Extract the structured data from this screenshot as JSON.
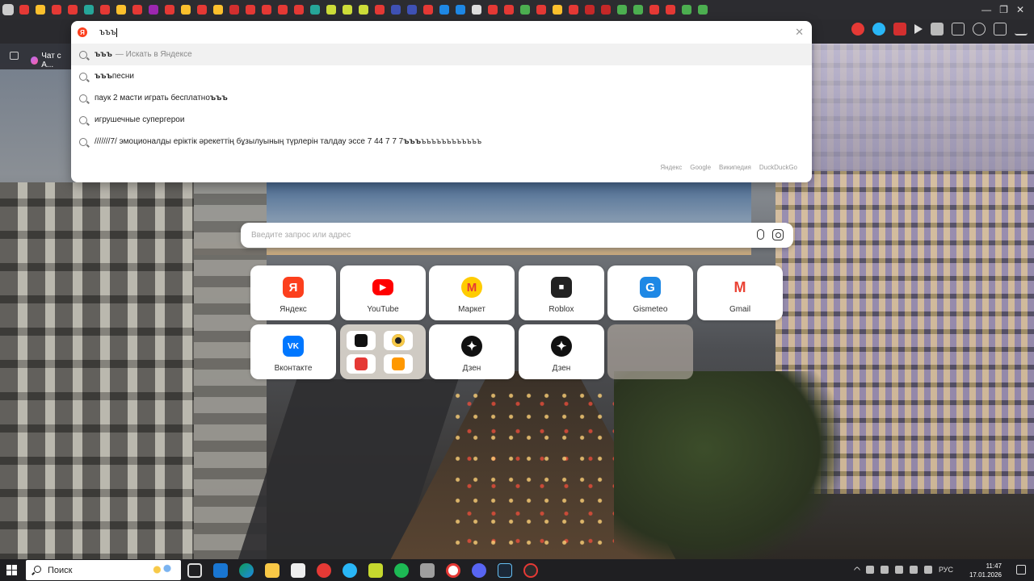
{
  "omnibox": {
    "query": "ъъъ",
    "suggestions": [
      {
        "bold": "ъъъ",
        "rest": "",
        "hint": "— Искать в Яндексе"
      },
      {
        "bold": "ъъъ",
        "rest": " песни",
        "hint": ""
      },
      {
        "bold": "",
        "rest": "паук 2 масти играть бесплатно ",
        "tail_bold": "ъъъ",
        "hint": ""
      },
      {
        "bold": "",
        "rest": "игрушечные супергерои",
        "hint": ""
      },
      {
        "bold": "",
        "rest": "///////7/ эмоционалды еріктік әрекеттің бұзылуының түрлерін талдау эссе 7 44 7 7 7 ",
        "tail_bold": "ъъъ",
        "tail": "ъъъъъъъъъъъъ",
        "hint": ""
      }
    ],
    "engines": [
      "Яндекс",
      "Google",
      "Википедия",
      "DuckDuckGo"
    ]
  },
  "browser": {
    "chat_tab_label": "Чат с А...",
    "ya_badge": "Я"
  },
  "ntp": {
    "search_placeholder": "Введите запрос или адрес",
    "tiles": [
      {
        "label": "Яндекс",
        "icon": "yandex-icon",
        "color": "#fc3f1d",
        "glyph": "Я"
      },
      {
        "label": "YouTube",
        "icon": "youtube-icon",
        "color": "#ff0000",
        "glyph": "▶"
      },
      {
        "label": "Маркет",
        "icon": "market-icon",
        "color": "#ffcc00",
        "glyph": "M"
      },
      {
        "label": "Roblox",
        "icon": "roblox-icon",
        "color": "#222222",
        "glyph": "■"
      },
      {
        "label": "Gismeteo",
        "icon": "gismeteo-icon",
        "color": "#1e88e5",
        "glyph": "G"
      },
      {
        "label": "Gmail",
        "icon": "gmail-icon",
        "color": "#ea4335",
        "glyph": "M"
      },
      {
        "label": "Вконтакте",
        "icon": "vk-icon",
        "color": "#0077ff",
        "glyph": "VK"
      },
      {
        "label": "Дзен",
        "icon": "dzen-icon",
        "color": "#111111",
        "glyph": "✦"
      },
      {
        "label": "Дзен",
        "icon": "dzen-icon",
        "color": "#111111",
        "glyph": "✦"
      }
    ]
  },
  "taskbar": {
    "search_label": "Поиск",
    "lang": "РУС",
    "time": "11:47",
    "date": "17.01.2026"
  }
}
